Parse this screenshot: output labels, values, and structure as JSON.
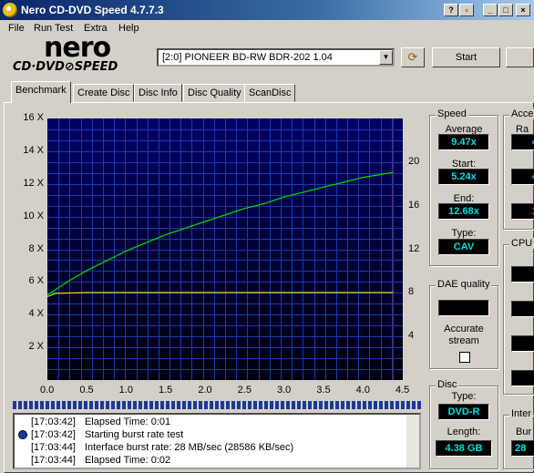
{
  "window": {
    "title": "Nero CD-DVD Speed 4.7.7.3",
    "buttons": [
      "help",
      "restore-small",
      "minimize",
      "maximize",
      "close"
    ]
  },
  "menu": [
    "File",
    "Run Test",
    "Extra",
    "Help"
  ],
  "logo": {
    "brand": "nero",
    "product": "CD·DVD⊘SPEED"
  },
  "drive": {
    "selected": "[2:0]  PIONEER BD-RW   BDR-202 1.04"
  },
  "toolbar": {
    "start_label": "Start"
  },
  "tabs": [
    "Benchmark",
    "Create Disc",
    "Disc Info",
    "Disc Quality",
    "ScanDisc"
  ],
  "active_tab": "Benchmark",
  "chart_data": {
    "type": "line",
    "x_ticks": [
      "0.0",
      "0.5",
      "1.0",
      "1.5",
      "2.0",
      "2.5",
      "3.0",
      "3.5",
      "4.0",
      "4.5"
    ],
    "y_left_ticks": [
      "16 X",
      "14 X",
      "12 X",
      "10 X",
      "8 X",
      "6 X",
      "4 X",
      "2 X"
    ],
    "y_right_ticks": [
      "20",
      "16",
      "12",
      "8",
      "4"
    ],
    "xlim": [
      0,
      4.5
    ],
    "ylim_left": [
      0,
      16
    ],
    "ylim_right": [
      0,
      24
    ],
    "marker_x": 4.38,
    "series": [
      {
        "color": "#00e000",
        "x": [
          0.0,
          0.25,
          0.5,
          0.75,
          1.0,
          1.25,
          1.5,
          1.75,
          2.0,
          2.25,
          2.5,
          2.75,
          3.0,
          3.25,
          3.5,
          3.75,
          4.0,
          4.25,
          4.38
        ],
        "y": [
          5.2,
          6.0,
          6.7,
          7.3,
          7.9,
          8.4,
          8.9,
          9.3,
          9.7,
          10.1,
          10.5,
          10.8,
          11.2,
          11.5,
          11.8,
          12.1,
          12.4,
          12.6,
          12.7
        ]
      },
      {
        "color": "#e0e000",
        "x": [
          0.0,
          0.1,
          0.5,
          1.0,
          1.5,
          2.0,
          2.5,
          3.0,
          3.5,
          4.0,
          4.38
        ],
        "y": [
          5.1,
          5.3,
          5.35,
          5.35,
          5.35,
          5.35,
          5.35,
          5.35,
          5.35,
          5.35,
          5.35
        ]
      }
    ]
  },
  "speed": {
    "title": "Speed",
    "average_label": "Average",
    "average": "9.47x",
    "start_label": "Start:",
    "start": "5.24x",
    "end_label": "End:",
    "end": "12.68x",
    "type_label": "Type:",
    "type": "CAV"
  },
  "access": {
    "title": "Acce",
    "row1_label": "Ra",
    "values": [
      "4",
      "4",
      "1"
    ]
  },
  "cpu": {
    "title": "CPU"
  },
  "dae": {
    "title": "DAE quality",
    "accurate_label": "Accurate",
    "stream_label": "stream",
    "checked": false
  },
  "disc": {
    "title": "Disc",
    "type_label": "Type:",
    "type": "DVD-R",
    "length_label": "Length:",
    "length": "4.38 GB"
  },
  "interface": {
    "title": "Inter",
    "burst_label": "Bur",
    "burst": "28"
  },
  "log": [
    {
      "time": "[17:03:42]",
      "text": "Elapsed Time:  0:01",
      "icon": false
    },
    {
      "time": "[17:03:42]",
      "text": "Starting burst rate test",
      "icon": true
    },
    {
      "time": "[17:03:44]",
      "text": "Interface burst rate: 28 MB/sec (28586 KB/sec)",
      "icon": false
    },
    {
      "time": "[17:03:44]",
      "text": "Elapsed Time:  0:02",
      "icon": false
    }
  ]
}
